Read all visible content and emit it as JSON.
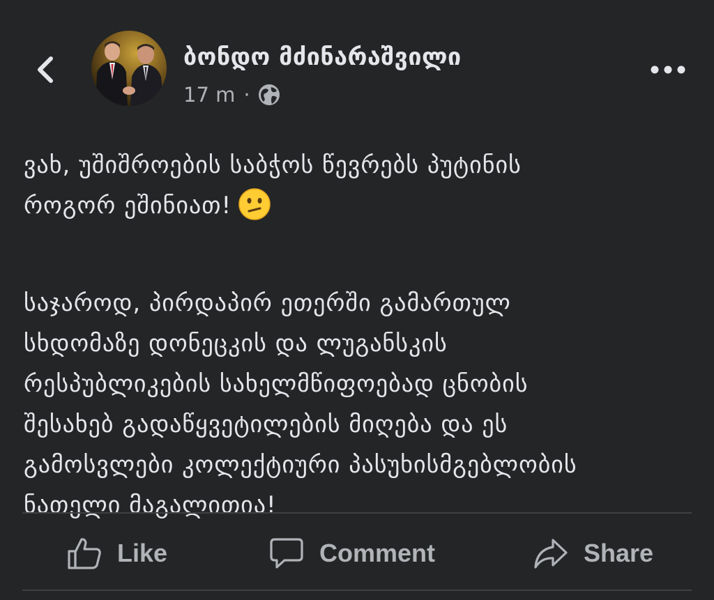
{
  "header": {
    "author_name": "ბონდო მძინარაშვილი",
    "timestamp": "17 m",
    "separator": "·",
    "privacy_icon": "globe-icon",
    "back_icon": "chevron-left-icon",
    "more_icon": "more-horizontal-icon"
  },
  "post": {
    "paragraph1": "ვახ, უშიშროების საბჭოს წევრებს პუტინის\nროგორ ეშინიათ!",
    "paragraph1_emoji": "confused-face-icon",
    "paragraph2": "საჯაროდ, პირდაპირ ეთერში გამართულ\nსხდომაზე დონეცკის და ლუგანსკის\nრესპუბლიკების სახელმწიფოებად ცნობის\nშესახებ გადაწყვეტილების მიღება და ეს\nგამოსვლები კოლექტიური პასუხისმგებლობის\nნათელი მაგალითია!"
  },
  "actions": {
    "like_label": "Like",
    "comment_label": "Comment",
    "share_label": "Share"
  },
  "colors": {
    "background": "#242526",
    "primary_text": "#e4e6eb",
    "secondary_text": "#b0b3b8",
    "divider": "#3e4042",
    "emoji_face": "#ffcc33"
  }
}
